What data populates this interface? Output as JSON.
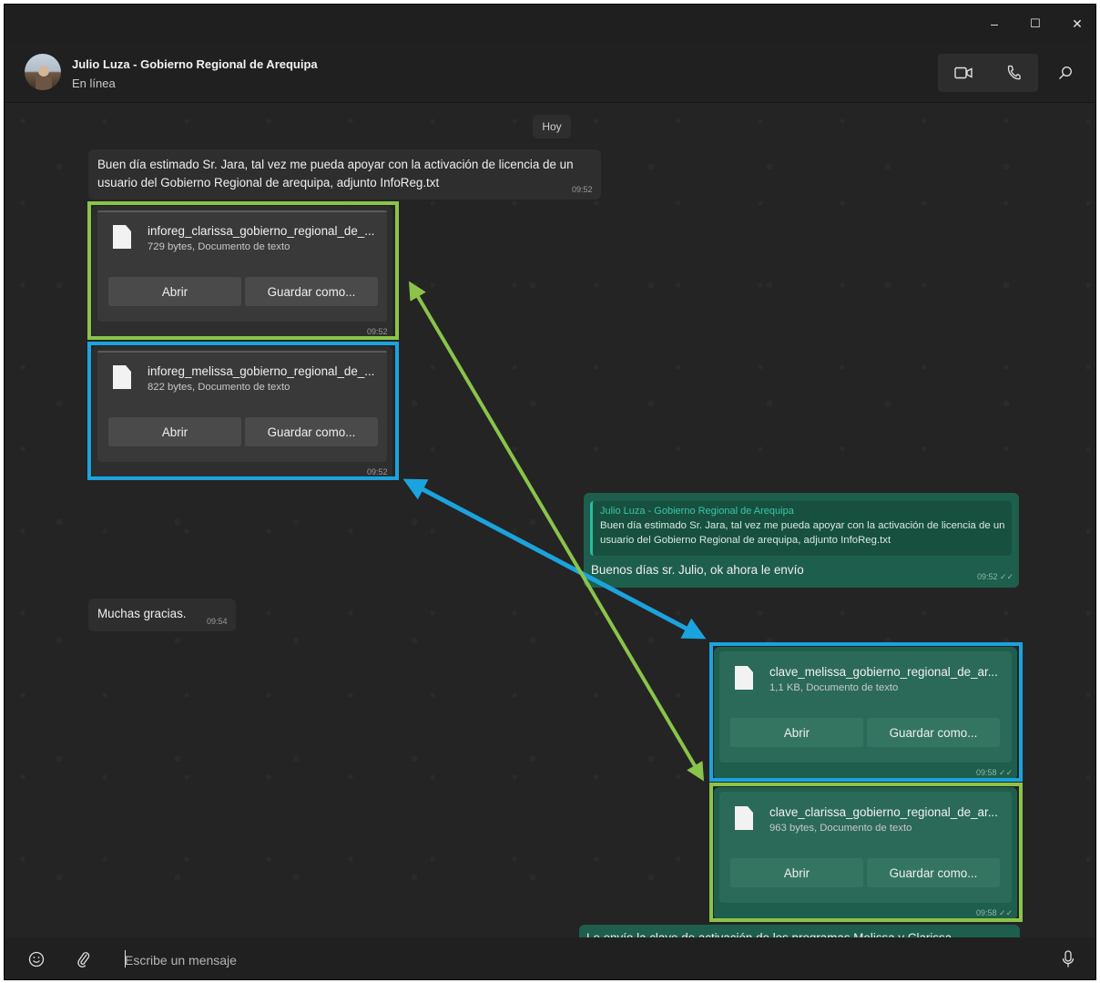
{
  "window": {
    "controls": {
      "minimize": "–",
      "maximize": "☐",
      "close": "✕"
    }
  },
  "header": {
    "name": "Julio Luza - Gobierno Regional de Arequipa",
    "status": "En línea",
    "icons": [
      "video-call-icon",
      "voice-call-icon",
      "search-icon"
    ]
  },
  "chat": {
    "date_label": "Hoy",
    "msg1": {
      "text": "Buen día estimado Sr. Jara, tal vez me pueda apoyar con la activación de licencia de un usuario del Gobierno Regional de arequipa, adjunto InfoReg.txt",
      "time": "09:52"
    },
    "file1": {
      "name": "inforeg_clarissa_gobierno_regional_de_...",
      "meta": "729 bytes, Documento de texto",
      "open": "Abrir",
      "save": "Guardar como...",
      "time": "09:52"
    },
    "file2": {
      "name": "inforeg_melissa_gobierno_regional_de_...",
      "meta": "822 bytes, Documento de texto",
      "open": "Abrir",
      "save": "Guardar como...",
      "time": "09:52"
    },
    "reply": {
      "quote_name": "Julio Luza - Gobierno Regional de Arequipa",
      "quote_text": "Buen día estimado Sr. Jara, tal vez me pueda apoyar con la activación de licencia de un usuario del Gobierno Regional de arequipa, adjunto InfoReg.txt",
      "text": "Buenos días sr. Julio, ok ahora le envío",
      "time": "09:52 ✓✓"
    },
    "msg_thanks": {
      "text": "Muchas gracias.",
      "time": "09:54"
    },
    "file3": {
      "name": "clave_melissa_gobierno_regional_de_ar...",
      "meta": "1,1 KB, Documento de texto",
      "open": "Abrir",
      "save": "Guardar como...",
      "time": "09:58 ✓✓"
    },
    "file4": {
      "name": "clave_clarissa_gobierno_regional_de_ar...",
      "meta": "963 bytes, Documento de texto",
      "open": "Abrir",
      "save": "Guardar como...",
      "time": "09:58 ✓✓"
    },
    "last_msg": {
      "text": "Le envío la clave de activación de los programas Melissa y Clarissa"
    }
  },
  "annotation_colors": {
    "green": "#8ac44a",
    "blue": "#1ba3dd"
  },
  "composer": {
    "placeholder": "Escribe un mensaje",
    "icons": [
      "emoji-icon",
      "attach-icon",
      "microphone-icon"
    ]
  }
}
